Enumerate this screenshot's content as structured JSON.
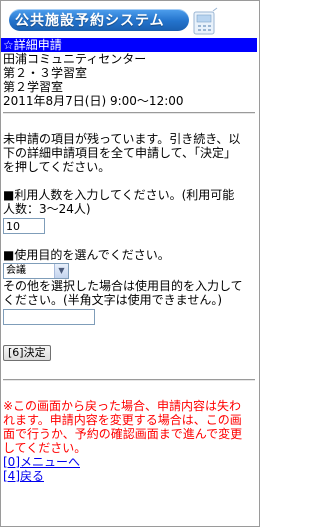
{
  "app": {
    "logo_text": "公共施設予約システム"
  },
  "header": {
    "title": "☆詳細申請"
  },
  "reservation": {
    "facility": "田浦コミュニティセンター",
    "room_1": "第２・３学習室",
    "room_2": "第２学習室",
    "datetime": "2011年8月7日(日) 9:00〜12:00"
  },
  "instructions": {
    "line1": "未申請の項目が残っています。引き続き、以",
    "line2": "下の詳細申請項目を全て申請して、「決定」",
    "line3": "を押してください。"
  },
  "people": {
    "label_line1": "■利用人数を入力してください。(利用可能",
    "label_line2": "人数：3〜24人)",
    "value": "10"
  },
  "purpose": {
    "label": "■使用目的を選んでください。",
    "selected": "会議",
    "note_line1": "その他を選択した場合は使用目的を入力して",
    "note_line2": "ください。(半角文字は使用できません。)",
    "other_value": ""
  },
  "submit": {
    "label": "[6]決定"
  },
  "warning": {
    "line1": "※この画面から戻った場合、申請内容は失わ",
    "line2": "れます。申請内容を変更する場合は、この画",
    "line3": "面で行うか、予約の確認画面まで進んで変更",
    "line4": "してください。"
  },
  "links": {
    "menu": "[0]メニューへ",
    "back": "[4]戻る"
  },
  "colors": {
    "header_bg": "#0000ff",
    "warning": "#ff0000",
    "link": "#0000ee",
    "logo_blue": "#2373cc"
  }
}
